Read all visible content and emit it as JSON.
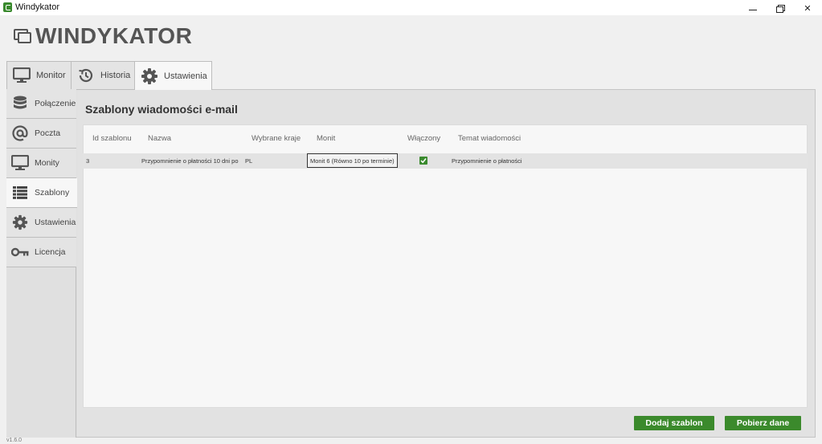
{
  "window": {
    "title": "Windykator"
  },
  "logo": {
    "text": "WINDYKATOR"
  },
  "tabs": [
    {
      "label": "Monitor",
      "icon": "monitor-icon"
    },
    {
      "label": "Historia",
      "icon": "history-icon"
    },
    {
      "label": "Ustawienia",
      "icon": "gear-icon",
      "active": true
    }
  ],
  "sidebar": {
    "items": [
      {
        "label": "Połączenie",
        "icon": "database-icon"
      },
      {
        "label": "Poczta",
        "icon": "at-icon"
      },
      {
        "label": "Monity",
        "icon": "monitor-icon"
      },
      {
        "label": "Szablony",
        "icon": "list-icon",
        "active": true
      },
      {
        "label": "Ustawienia",
        "icon": "gear-icon"
      },
      {
        "label": "Licencja",
        "icon": "key-icon"
      }
    ]
  },
  "content": {
    "title": "Szablony wiadomości e-mail",
    "table": {
      "columns": [
        "Id szablonu",
        "Nazwa",
        "Wybrane kraje",
        "Monit",
        "Włączony",
        "Temat wiadomości"
      ],
      "rows": [
        {
          "id": "3",
          "name": "Przypomnienie o płatności 10 dni po",
          "countries": "PL",
          "monit": "Monit 6 (Równo 10 po terminie)",
          "enabled": true,
          "subject": "Przypomnienie o płatności"
        }
      ]
    }
  },
  "buttons": {
    "add": "Dodaj szablon",
    "fetch": "Pobierz dane"
  },
  "version": "v1.6.0",
  "colors": {
    "accent": "#3b8a2c",
    "logo": "#555555"
  }
}
